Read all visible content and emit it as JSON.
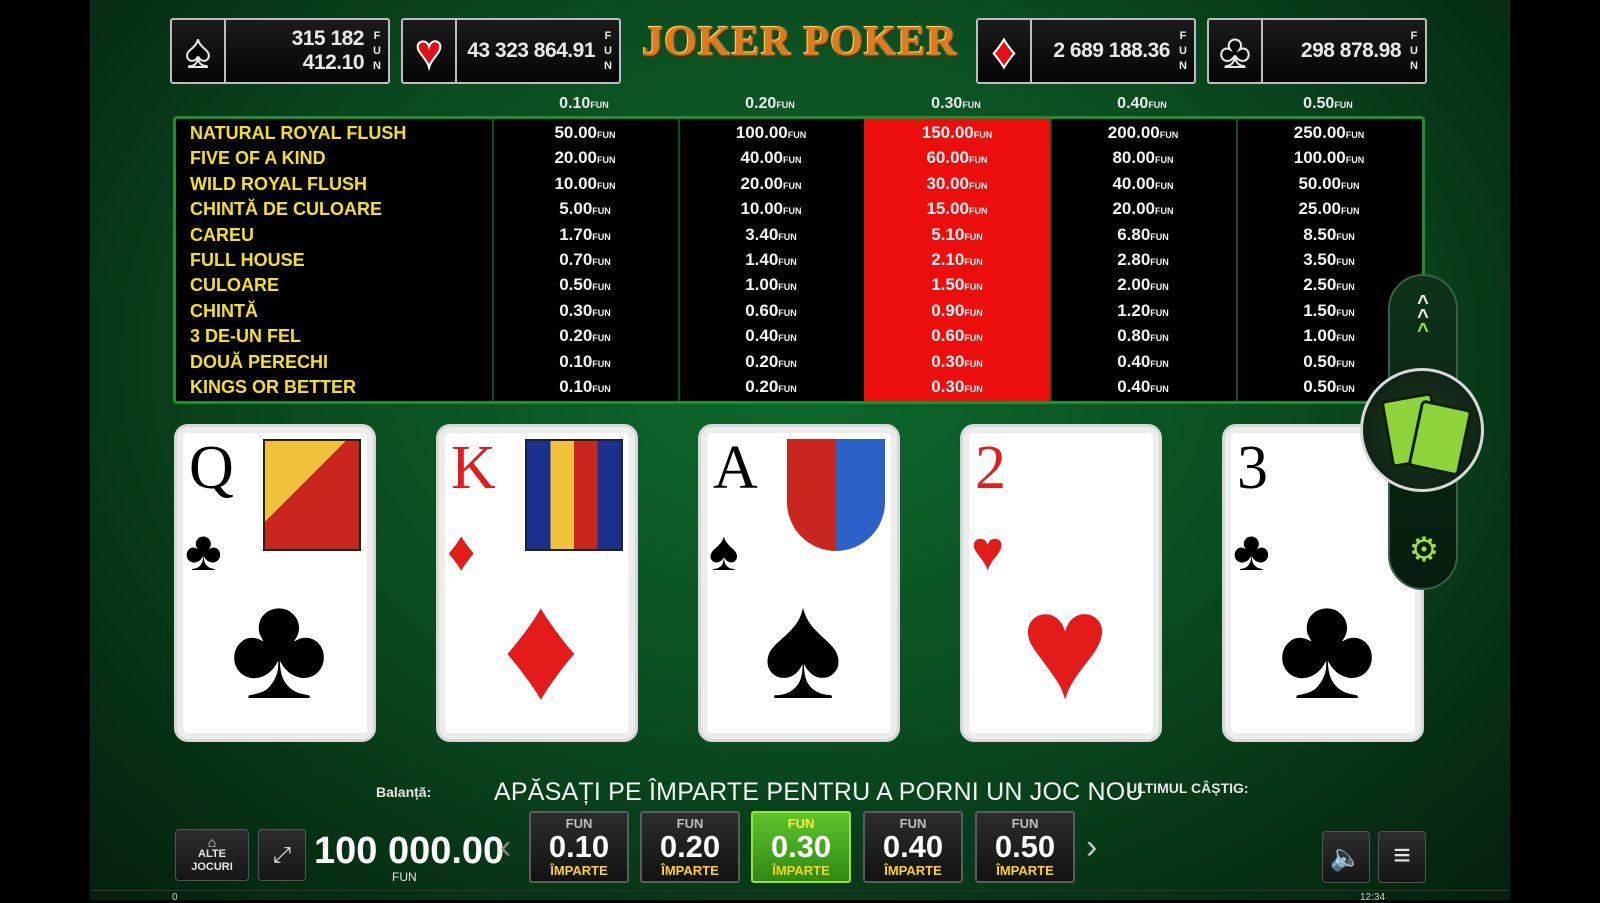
{
  "title": "JOKER POKER",
  "jackpots": [
    {
      "suit": "spade",
      "symbol": "♠",
      "value": "315 182 412.10",
      "unit": "FUN"
    },
    {
      "suit": "heart",
      "symbol": "♥",
      "value": "43 323 864.91",
      "unit": "FUN"
    },
    {
      "suit": "diamond",
      "symbol": "♦",
      "value": "2 689 188.36",
      "unit": "FUN"
    },
    {
      "suit": "club",
      "symbol": "♣",
      "value": "298 878.98",
      "unit": "FUN"
    }
  ],
  "paytable": {
    "bets": [
      "0.10",
      "0.20",
      "0.30",
      "0.40",
      "0.50"
    ],
    "unit": "FUN",
    "highlighted_index": 2,
    "hands": [
      {
        "name": "NATURAL ROYAL FLUSH",
        "pays": [
          "50.00",
          "100.00",
          "150.00",
          "200.00",
          "250.00"
        ]
      },
      {
        "name": "FIVE OF A KIND",
        "pays": [
          "20.00",
          "40.00",
          "60.00",
          "80.00",
          "100.00"
        ]
      },
      {
        "name": "WILD ROYAL FLUSH",
        "pays": [
          "10.00",
          "20.00",
          "30.00",
          "40.00",
          "50.00"
        ]
      },
      {
        "name": "CHINTĂ DE CULOARE",
        "pays": [
          "5.00",
          "10.00",
          "15.00",
          "20.00",
          "25.00"
        ]
      },
      {
        "name": "CAREU",
        "pays": [
          "1.70",
          "3.40",
          "5.10",
          "6.80",
          "8.50"
        ]
      },
      {
        "name": "FULL HOUSE",
        "pays": [
          "0.70",
          "1.40",
          "2.10",
          "2.80",
          "3.50"
        ]
      },
      {
        "name": "CULOARE",
        "pays": [
          "0.50",
          "1.00",
          "1.50",
          "2.00",
          "2.50"
        ]
      },
      {
        "name": "CHINTĂ",
        "pays": [
          "0.30",
          "0.60",
          "0.90",
          "1.20",
          "1.50"
        ]
      },
      {
        "name": "3 DE-UN FEL",
        "pays": [
          "0.20",
          "0.40",
          "0.60",
          "0.80",
          "1.00"
        ]
      },
      {
        "name": "DOUĂ PERECHI",
        "pays": [
          "0.10",
          "0.20",
          "0.30",
          "0.40",
          "0.50"
        ]
      },
      {
        "name": "KINGS OR BETTER",
        "pays": [
          "0.10",
          "0.20",
          "0.30",
          "0.40",
          "0.50"
        ]
      }
    ]
  },
  "cards": [
    {
      "rank": "Q",
      "suit": "♣",
      "color": "#000000"
    },
    {
      "rank": "K",
      "suit": "♦",
      "color": "#e31b1b"
    },
    {
      "rank": "A",
      "suit": "♠",
      "color": "#000000"
    },
    {
      "rank": "2",
      "suit": "♥",
      "color": "#e31b1b"
    },
    {
      "rank": "3",
      "suit": "♣",
      "color": "#000000"
    }
  ],
  "bottom": {
    "balance_label": "Balanță:",
    "balance_value": "100 000.00",
    "balance_unit": "FUN",
    "message": "APĂSAȚI PE ÎMPARTE PENTRU A PORNI UN JOC NOU",
    "last_win_label": "ULTIMUL CÂȘTIG:",
    "other_games_label_1": "ALTE",
    "other_games_label_2": "JOCURI",
    "bet_buttons": [
      {
        "unit": "FUN",
        "value": "0.10",
        "action": "ÎMPARTE",
        "active": false
      },
      {
        "unit": "FUN",
        "value": "0.20",
        "action": "ÎMPARTE",
        "active": false
      },
      {
        "unit": "FUN",
        "value": "0.30",
        "action": "ÎMPARTE",
        "active": true
      },
      {
        "unit": "FUN",
        "value": "0.40",
        "action": "ÎMPARTE",
        "active": false
      },
      {
        "unit": "FUN",
        "value": "0.50",
        "action": "ÎMPARTE",
        "active": false
      }
    ]
  },
  "footer": {
    "left": "0",
    "right": "12:34"
  },
  "colors": {
    "felt": "#0a4f21",
    "highlight": "#ec0d0d",
    "hand_text": "#f4e11a",
    "active_button": "#5ec42c",
    "border_green": "#1e8f31"
  }
}
